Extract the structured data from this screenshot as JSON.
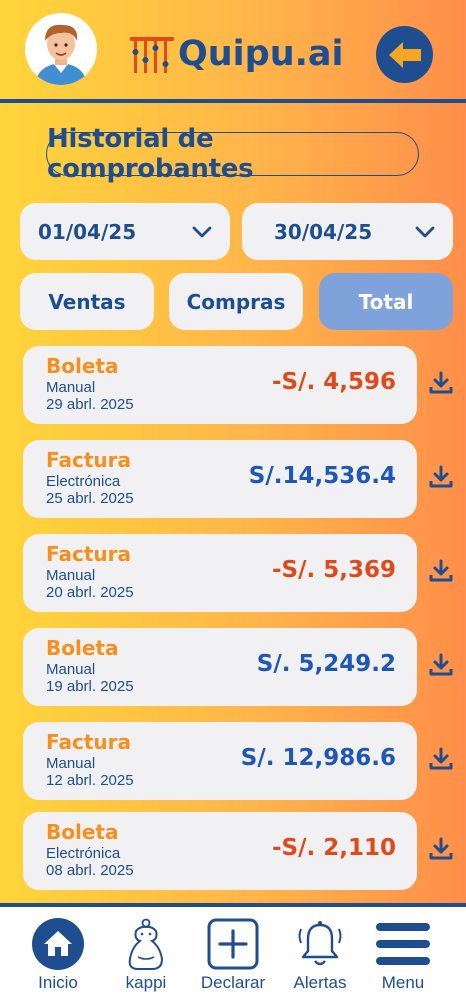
{
  "app": {
    "logo_text": "Quipu.ai"
  },
  "header": {
    "avatar_icon": "user-avatar",
    "back_icon": "arrow-left-icon"
  },
  "page": {
    "title": "Historial de comprobantes"
  },
  "filters": {
    "date_from": "01/04/25",
    "date_to": "30/04/25"
  },
  "tabs": [
    {
      "label": "Ventas",
      "active": false
    },
    {
      "label": "Compras",
      "active": false
    },
    {
      "label": "Total",
      "active": true
    }
  ],
  "receipts": [
    {
      "type": "Boleta",
      "mode": "Manual",
      "date": "29 abrl. 2025",
      "amount": "-S/. 4,596",
      "negative": true
    },
    {
      "type": "Factura",
      "mode": "Electrónica",
      "date": "25 abrl. 2025",
      "amount": "S/.14,536.4",
      "negative": false
    },
    {
      "type": "Factura",
      "mode": "Manual",
      "date": "20 abrl. 2025",
      "amount": "-S/. 5,369",
      "negative": true
    },
    {
      "type": "Boleta",
      "mode": "Manual",
      "date": "19 abrl. 2025",
      "amount": "S/. 5,249.2",
      "negative": false
    },
    {
      "type": "Factura",
      "mode": "Manual",
      "date": "12 abrl. 2025",
      "amount": "S/. 12,986.6",
      "negative": false
    },
    {
      "type": "Boleta",
      "mode": "Electrónica",
      "date": "08 abrl. 2025",
      "amount": "-S/. 2,110",
      "negative": true
    }
  ],
  "nav": [
    {
      "label": "Inicio",
      "icon": "home-icon"
    },
    {
      "label": "kappi",
      "icon": "capybara-icon"
    },
    {
      "label": "Declarar",
      "icon": "plus-square-icon"
    },
    {
      "label": "Alertas",
      "icon": "bell-icon"
    },
    {
      "label": "Menu",
      "icon": "hamburger-menu-icon"
    }
  ],
  "colors": {
    "primary": "#1E4E8F",
    "accent_orange": "#F5901E",
    "negative": "#E04A1A",
    "positive": "#1E57B8",
    "active_tab": "#7FA2DB"
  }
}
